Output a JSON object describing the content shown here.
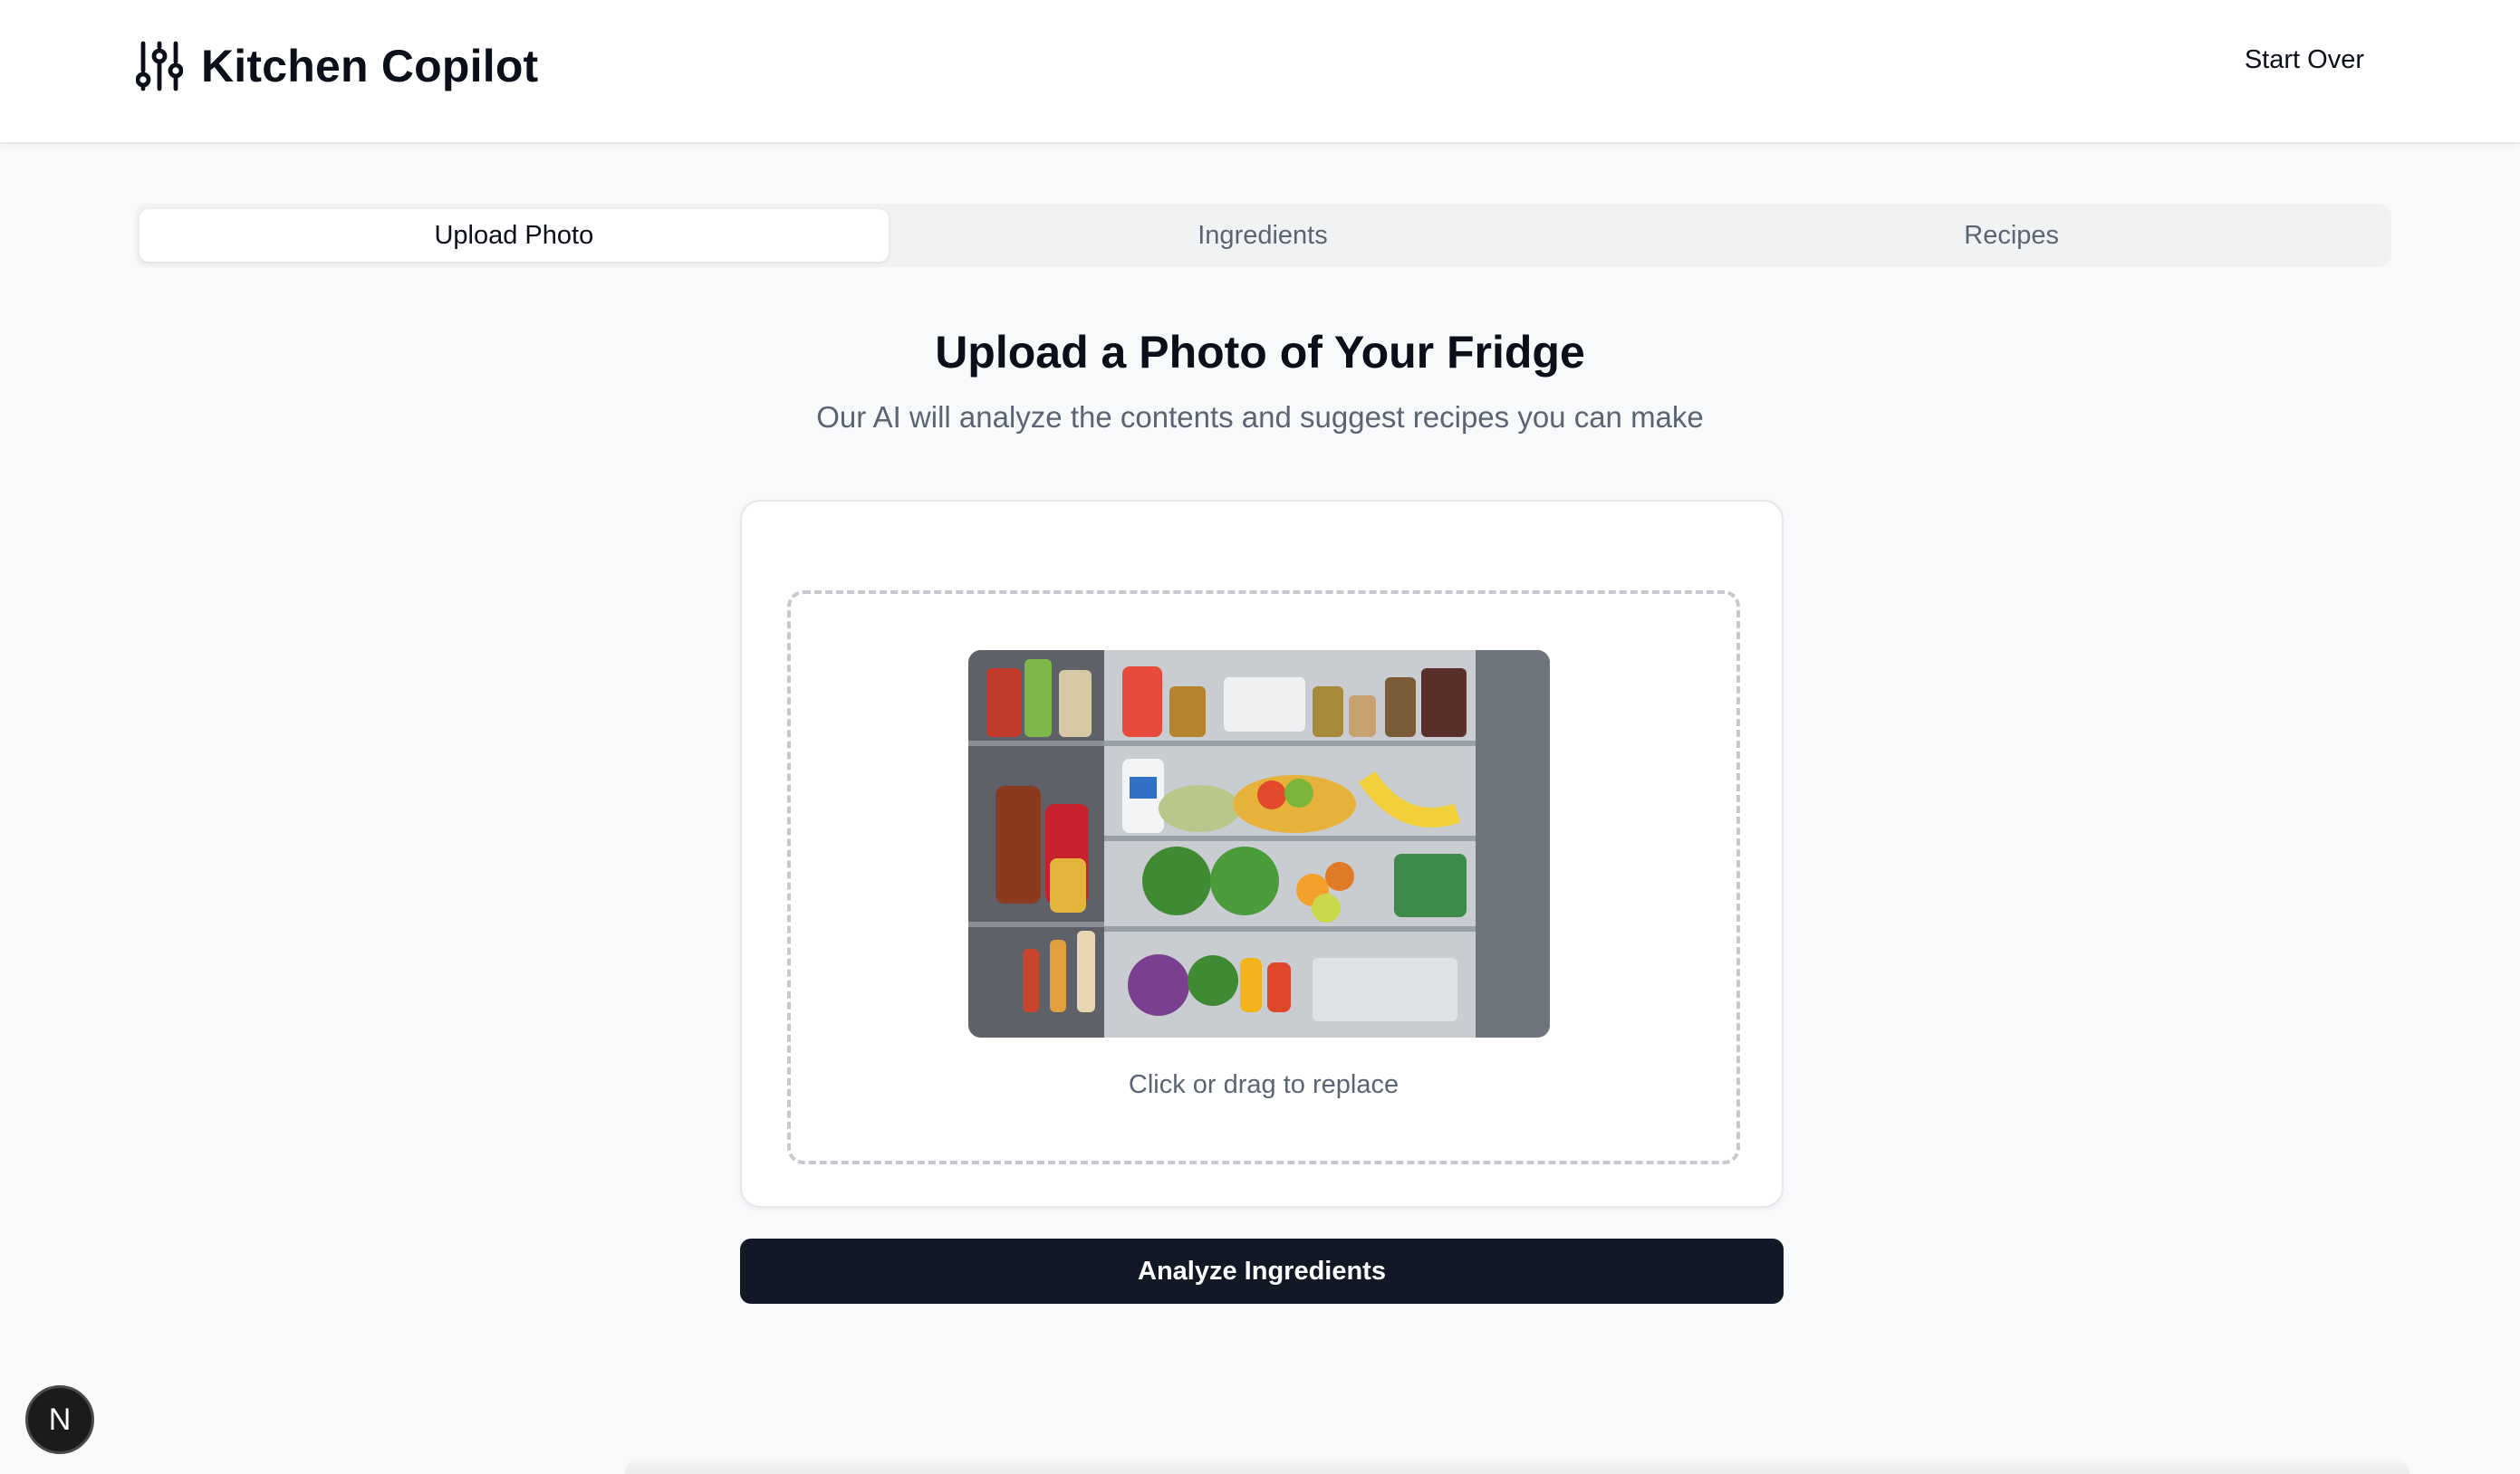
{
  "header": {
    "title": "Kitchen Copilot",
    "logo_icon": "sliders-icon",
    "start_over_label": "Start Over"
  },
  "tabs": [
    {
      "label": "Upload Photo",
      "active": true
    },
    {
      "label": "Ingredients",
      "active": false
    },
    {
      "label": "Recipes",
      "active": false
    }
  ],
  "main": {
    "title": "Upload a Photo of Your Fridge",
    "subtitle": "Our AI will analyze the contents and suggest recipes you can make",
    "upload": {
      "hint": "Click or drag to replace",
      "image_alt": "Photo of open refrigerator with food"
    },
    "analyze_label": "Analyze Ingredients"
  },
  "dev_badge": {
    "label": "N"
  },
  "colors": {
    "primary_button": "#121826",
    "page_background": "#f8f9fb",
    "muted_text": "#5b6472"
  }
}
